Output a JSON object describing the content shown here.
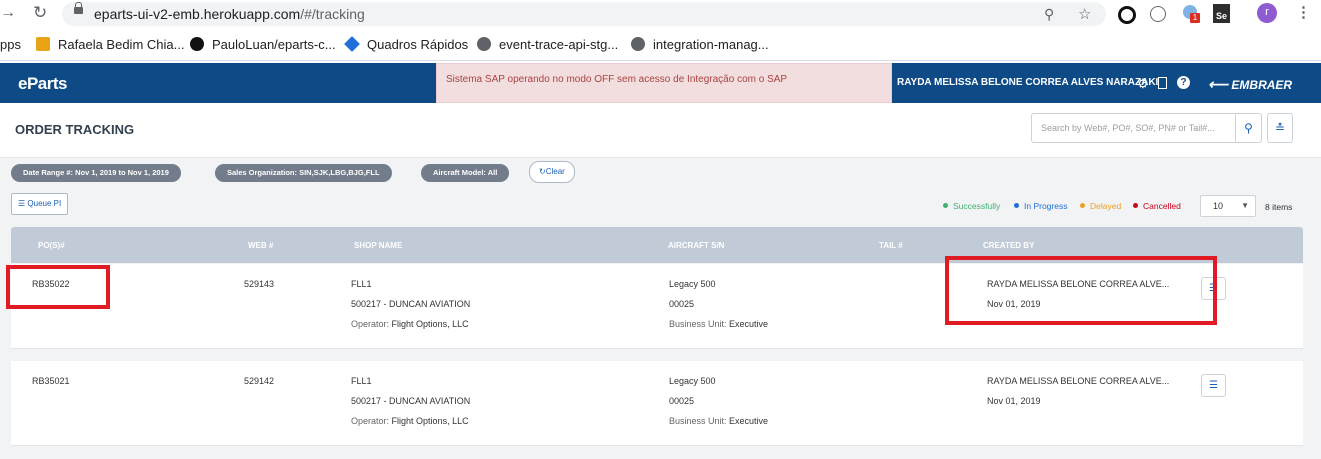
{
  "browser": {
    "url_host": "eparts-ui-v2-emb.herokuapp.com",
    "url_path": "/#/tracking",
    "bookmarks": [
      {
        "label": "pps"
      },
      {
        "label": "Rafaela Bedim Chia..."
      },
      {
        "label": "PauloLuan/eparts-c..."
      },
      {
        "label": "Quadros Rápidos"
      },
      {
        "label": "event-trace-api-stg..."
      },
      {
        "label": "integration-manag..."
      }
    ],
    "ext_badge": "1",
    "ext_se": "Se",
    "profile_initial": "r"
  },
  "header": {
    "logo": "eParts",
    "alert": "Sistema SAP operando no modo OFF sem acesso de Integração com o SAP",
    "user_name": "RAYDA MELISSA BELONE CORREA ALVES NARAZAKI",
    "brand": "EMBRAER"
  },
  "page": {
    "title": "ORDER TRACKING",
    "search_placeholder": "Search by Web#, PO#, SO#, PN# or Tail#..."
  },
  "filters": {
    "chips": [
      "Date Range #: Nov 1, 2019 to Nov 1, 2019",
      "Sales Organization: SIN,SJK,LBG,BJG,FLL",
      "Aircraft Model: All"
    ],
    "clear_label": "Clear"
  },
  "toolbar": {
    "queue_label": "Queue PI",
    "legend": [
      {
        "label": "Successfully",
        "color": "#3cb371"
      },
      {
        "label": "In Progress",
        "color": "#1f6fd6"
      },
      {
        "label": "Delayed",
        "color": "#f0a020"
      },
      {
        "label": "Cancelled",
        "color": "#d0021b"
      }
    ],
    "page_size": "10",
    "items_count": "8 items"
  },
  "table": {
    "columns": [
      "PO(S)#",
      "WEB #",
      "SHOP NAME",
      "AIRCRAFT S/N",
      "TAIL #",
      "CREATED BY"
    ],
    "rows": [
      {
        "po": "RB35022",
        "web": "529143",
        "shop": "FLL1",
        "shop_detail": "500217 - DUNCAN AVIATION",
        "operator_label": "Operator:",
        "operator": "Flight Options, LLC",
        "aircraft": "Legacy 500",
        "serial": "00025",
        "bu_label": "Business Unit:",
        "bu": "Executive",
        "created_by": "RAYDA MELISSA BELONE CORREA ALVE...",
        "created_date": "Nov 01, 2019"
      },
      {
        "po": "RB35021",
        "web": "529142",
        "shop": "FLL1",
        "shop_detail": "500217 - DUNCAN AVIATION",
        "operator_label": "Operator:",
        "operator": "Flight Options, LLC",
        "aircraft": "Legacy 500",
        "serial": "00025",
        "bu_label": "Business Unit:",
        "bu": "Executive",
        "created_by": "RAYDA MELISSA BELONE CORREA ALVE...",
        "created_date": "Nov 01, 2019"
      }
    ]
  }
}
